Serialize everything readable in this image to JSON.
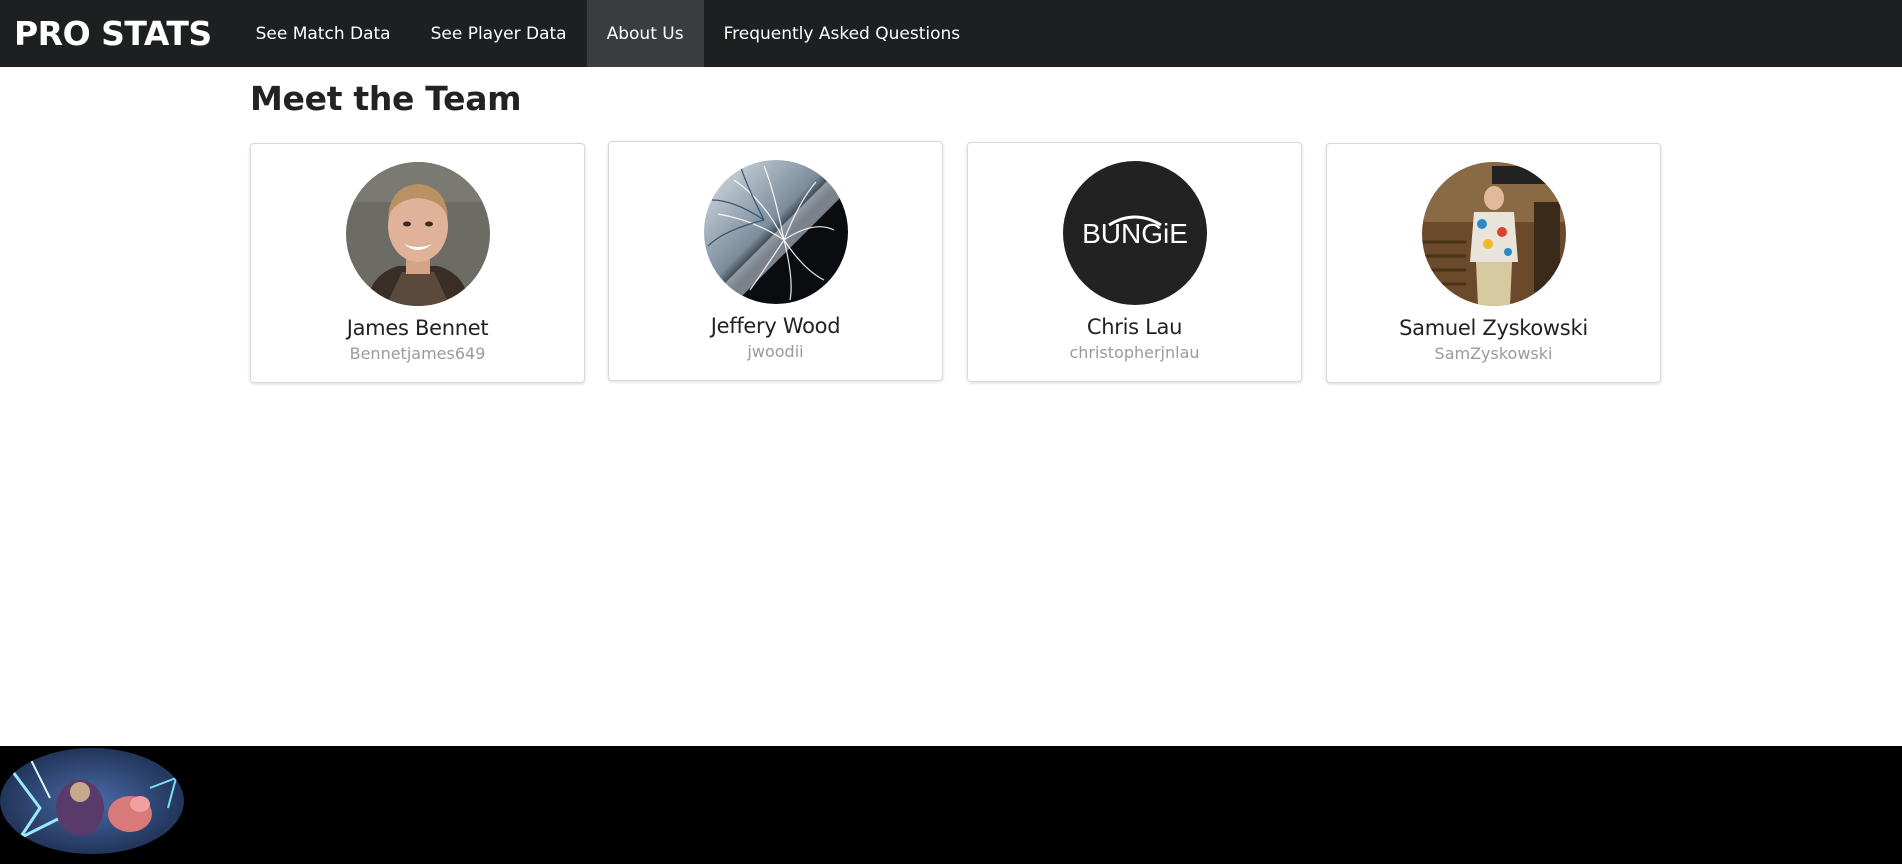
{
  "nav": {
    "brand": "PRO STATS",
    "links": [
      {
        "label": "See Match Data"
      },
      {
        "label": "See Player Data"
      },
      {
        "label": "About Us",
        "active": true
      },
      {
        "label": "Frequently Asked Questions"
      }
    ]
  },
  "main": {
    "title": "Meet the Team",
    "members": [
      {
        "name": "James Bennet",
        "handle": "Bennetjames649",
        "avatar_icon": "person-photo"
      },
      {
        "name": "Jeffery Wood",
        "handle": "jwoodii",
        "avatar_icon": "abstract-feather-art"
      },
      {
        "name": "Chris Lau",
        "handle": "christopherjnlau",
        "avatar_icon": "bungie-logo",
        "logo_text": "BUNGiE"
      },
      {
        "name": "Samuel Zyskowski",
        "handle": "SamZyskowski",
        "avatar_icon": "person-photo-station"
      }
    ]
  },
  "colors": {
    "navbar_bg": "#1e1f21",
    "nav_active_bg": "#3b3c3e",
    "footer_bg": "#000000",
    "handle_text": "#9a9a9a"
  }
}
